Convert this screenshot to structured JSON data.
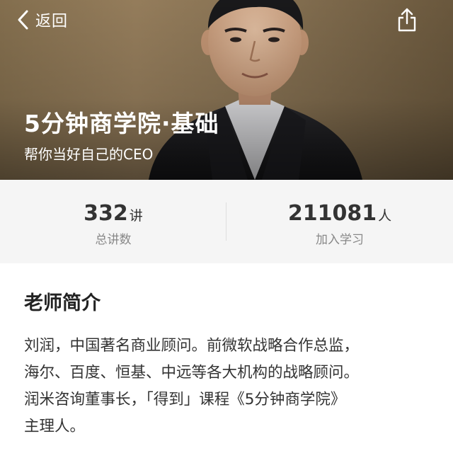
{
  "header": {
    "back_label": "返回",
    "title": "5分钟商学院·基础",
    "subtitle": "帮你当好自己的CEO"
  },
  "stats": {
    "lectures": {
      "value": "332",
      "unit": "讲",
      "caption": "总讲数"
    },
    "learners": {
      "value": "211081",
      "unit": "人",
      "caption": "加入学习"
    }
  },
  "teacher": {
    "section_title": "老师简介",
    "intro_lines": [
      "刘润，中国著名商业顾问。前微软战略合作总监，",
      "海尔、百度、恒基、中远等各大机构的战略顾问。",
      "润米咨询董事长，「得到」课程《5分钟商学院》",
      "主理人。"
    ]
  },
  "icons": {
    "back": "chevron-left-icon",
    "share": "share-icon"
  },
  "colors": {
    "hero_bg": "#9c8360",
    "stats_bg": "#f5f5f5",
    "caption_gray": "#888888"
  }
}
